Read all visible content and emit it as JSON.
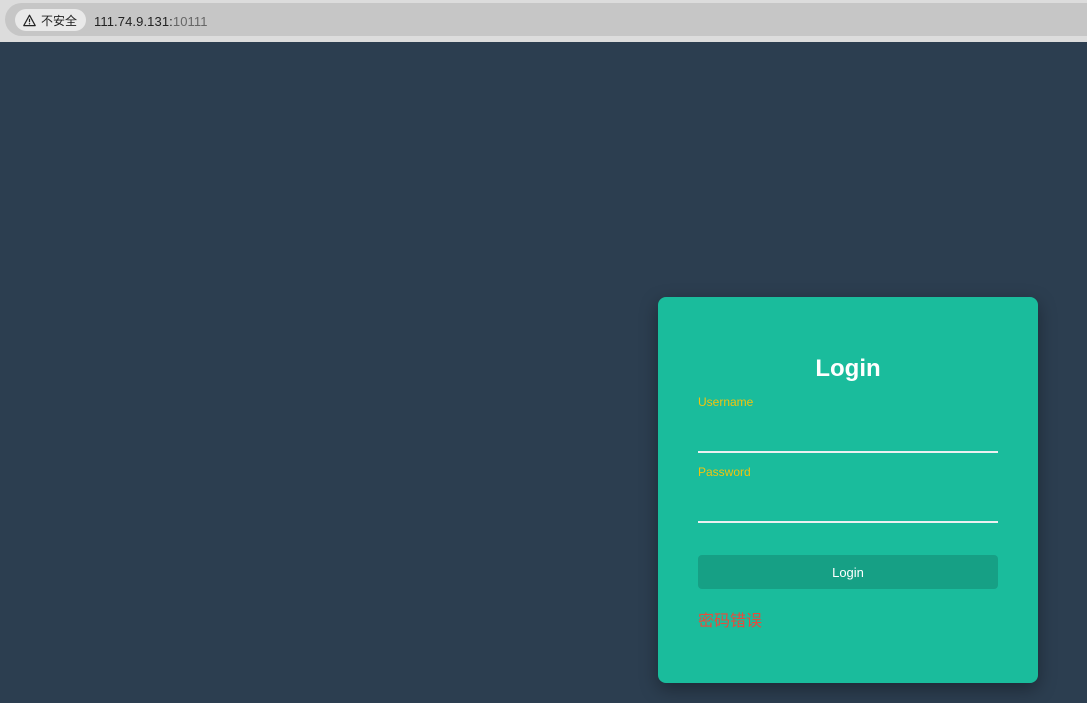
{
  "browser": {
    "security_label": "不安全",
    "url_host": "111.74.9.131:",
    "url_port": "10111",
    "icon": "warning-triangle-icon"
  },
  "login": {
    "title": "Login",
    "username_label": "Username",
    "username_value": "",
    "password_label": "Password",
    "password_value": "",
    "button_label": "Login",
    "error_message": "密码错误"
  },
  "colors": {
    "page_background": "#2c3e50",
    "card_background": "#1abc9c",
    "button_background": "#16a085",
    "label_color": "#f1c40f",
    "error_color": "#e74c3c"
  }
}
